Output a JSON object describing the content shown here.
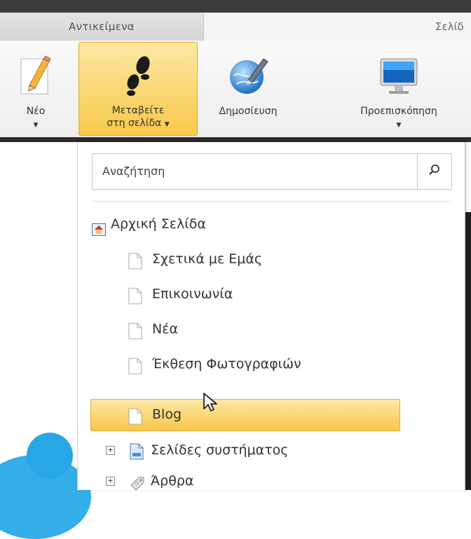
{
  "tabs": {
    "active": "Αντικείμενα",
    "next": "Σελίδ"
  },
  "ribbon": {
    "new": {
      "label": "Νέο",
      "icon": "pencil-icon"
    },
    "goto": {
      "label_line1": "Μεταβείτε",
      "label_line2": "στη σελίδα",
      "icon": "footprints-icon"
    },
    "publish": {
      "label": "Δημοσίευση",
      "icon": "globe-pen-icon"
    },
    "preview": {
      "label": "Προεπισκόπηση",
      "icon": "monitor-icon"
    }
  },
  "search": {
    "placeholder": "Αναζήτηση",
    "icon": "search-icon"
  },
  "tree": {
    "home": "Αρχική Σελίδα",
    "children": [
      "Σχετικά με Εμάς",
      "Επικοινωνία",
      "Νέα",
      "Έκθεση Φωτογραφιών",
      "Blog"
    ],
    "selected": "Blog",
    "system_pages": "Σελίδες συστήματος",
    "articles": "Άρθρα",
    "expander_symbol": "+"
  },
  "colors": {
    "selected_top": "#fde9a6",
    "selected_bottom": "#f8c64a",
    "accent_blue": "#33aee8"
  }
}
